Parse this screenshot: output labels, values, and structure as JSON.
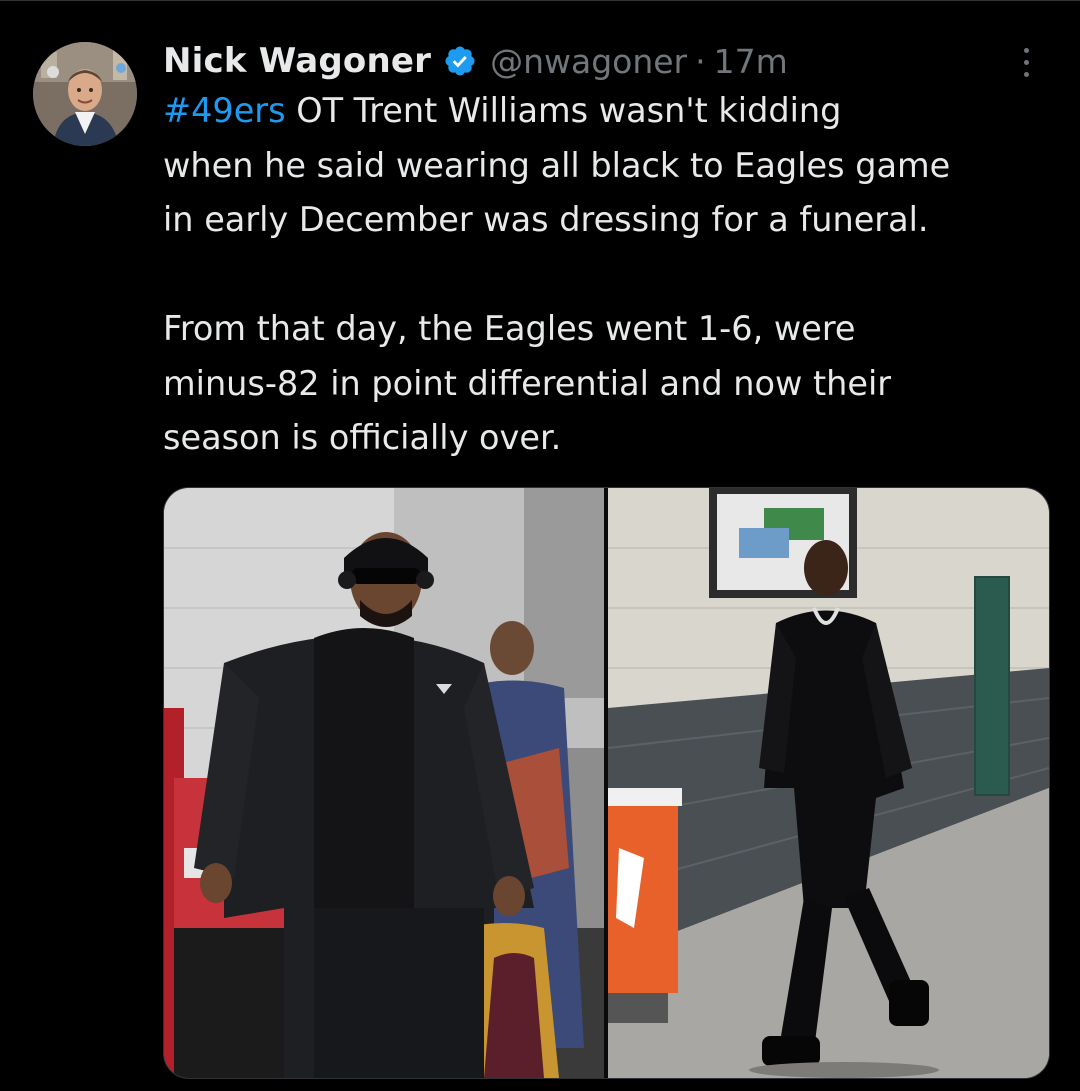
{
  "tweet": {
    "author_name": "Nick Wagoner",
    "handle": "@nwagoner",
    "separator": "·",
    "time": "17m",
    "hashtag": "#49ers",
    "paragraph1_lines": [
      " OT Trent Williams wasn't kidding",
      "when he said wearing all black to Eagles game",
      "in early December was dressing for a funeral."
    ],
    "paragraph2_lines": [
      "From that day, the Eagles went 1-6, were",
      "minus-82 in point differential and now their",
      "season is officially over."
    ]
  },
  "media": {
    "panels": [
      {
        "description_icon": "photo-player-in-hoodie-and-sunglasses"
      },
      {
        "description_icon": "photo-player-in-leather-outfit"
      }
    ]
  },
  "colors": {
    "background": "#000000",
    "text": "#e7e9ea",
    "secondary": "#71767b",
    "link": "#1d9bf0",
    "verified": "#1d9bf0"
  }
}
